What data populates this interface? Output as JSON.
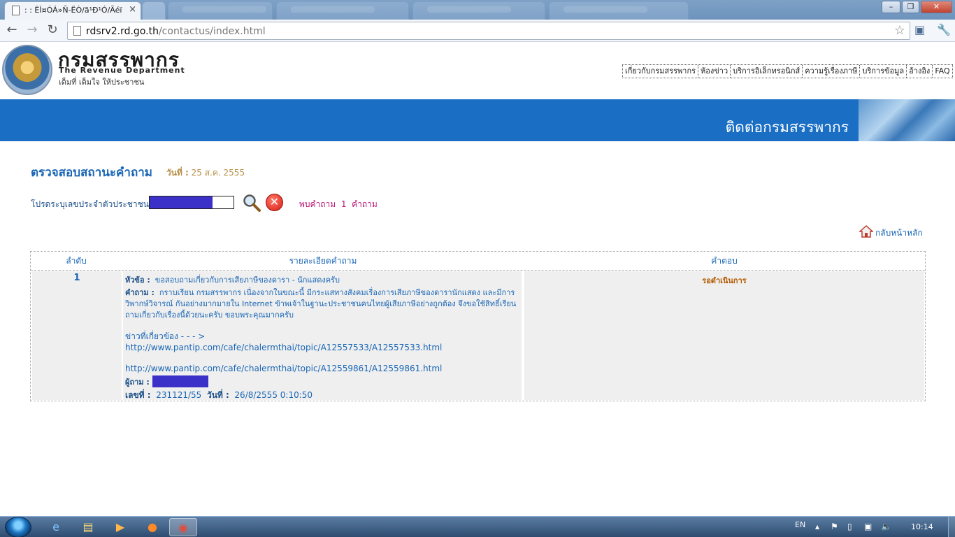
{
  "browser": {
    "active_tab_title": ": : ËÍ¤ÓÁ»Ñ-ËÒ/ã¹Ð¹Ó/Ãéï",
    "url_host": "rdsrv2.rd.go.th",
    "url_path": "/contactus/index.html"
  },
  "site": {
    "brand_thai": "กรมสรรพากร",
    "brand_en": "The Revenue Department",
    "slogan": "เต็มที่ เต็มใจ ให้ประชาชน",
    "nav": [
      "เกี่ยวกับกรมสรรพากร",
      "ห้องข่าว",
      "บริการอิเล็กทรอนิกส์",
      "ความรู้เรื่องภาษี",
      "บริการข้อมูล",
      "อ้างอิง",
      "FAQ"
    ],
    "banner_title": "ติดต่อกรมสรรพากร"
  },
  "status": {
    "title": "ตรวจสอบสถานะคำถาม",
    "date_label": "วันที่ :",
    "date_value": "25 ส.ค. 2555",
    "id_label": "โปรดระบุเลขประจำตัวประชาชน",
    "found_text": "พบคำถาม  1  คำถาม",
    "home_link": "กลับหน้าหลัก"
  },
  "table": {
    "headers": [
      "ลำดับ",
      "รายละเอียดคำถาม",
      "คำตอบ"
    ],
    "row": {
      "no": "1",
      "subject_label": "หัวข้อ :",
      "subject": "ขอสอบถามเกี่ยวกับการเสียภาษีของดารา - นักแสดงครับ",
      "question_label": "คำถาม :",
      "question": "กราบเรียน กรมสรรพากร เนื่องจากในขณะนี้ มีกระแสทางสังคมเรื่องการเสียภาษีของดารานักแสดง และมีการวิพากษ์วิจารณ์ กันอย่างมากมายใน Internet ข้าพเจ้าในฐานะประชาชนคนไทยผู้เสียภาษีอย่างถูกต้อง จึงขอใช้สิทธิ์เรียนถามเกี่ยวกับเรื่องนี้ด้วยนะครับ ขอบพระคุณมากครับ",
      "related_prefix": "ข่าวที่เกี่ยวข้อง - - - >",
      "link1": "http://www.pantip.com/cafe/chalermthai/topic/A12557533/A12557533.html",
      "link2": "http://www.pantip.com/cafe/chalermthai/topic/A12559861/A12559861.html",
      "asker_label": "ผู้ถาม :",
      "number_label": "เลขที่ :",
      "number": "231121/55",
      "date_label": "วันที่ :",
      "date": "26/8/2555 0:10:50",
      "answer": "รอดำเนินการ"
    }
  },
  "taskbar": {
    "lang": "EN",
    "clock": "10:14"
  }
}
